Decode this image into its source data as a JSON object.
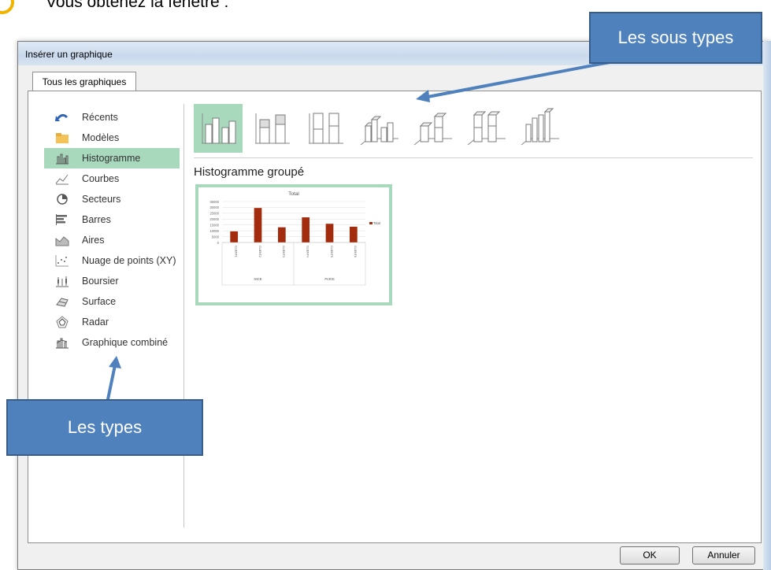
{
  "top_caption": "Vous obtenez la fenêtre :",
  "dialog": {
    "title": "Insérer un graphique",
    "tab_label": "Tous les graphiques",
    "chart_types": [
      {
        "label": "Récents",
        "icon": "recent-icon"
      },
      {
        "label": "Modèles",
        "icon": "folder-icon"
      },
      {
        "label": "Histogramme",
        "icon": "column-chart-icon",
        "selected": true
      },
      {
        "label": "Courbes",
        "icon": "line-chart-icon"
      },
      {
        "label": "Secteurs",
        "icon": "pie-chart-icon"
      },
      {
        "label": "Barres",
        "icon": "bar-chart-icon"
      },
      {
        "label": "Aires",
        "icon": "area-chart-icon"
      },
      {
        "label": "Nuage de points (XY)",
        "icon": "scatter-chart-icon"
      },
      {
        "label": "Boursier",
        "icon": "stock-chart-icon"
      },
      {
        "label": "Surface",
        "icon": "surface-chart-icon"
      },
      {
        "label": "Radar",
        "icon": "radar-chart-icon"
      },
      {
        "label": "Graphique combiné",
        "icon": "combo-chart-icon"
      }
    ],
    "subtype_title": "Histogramme groupé",
    "ok_label": "OK",
    "cancel_label": "Annuler"
  },
  "preview_chart": {
    "title": "Total",
    "legend": "Total",
    "y_ticks": [
      "35000",
      "30000",
      "25000",
      "20000",
      "15000",
      "10000",
      "5000",
      "0"
    ],
    "categories": [
      "CLIENT1",
      "CLIENT2",
      "CLIENT3",
      "CLIENT4",
      "CLIENT5",
      "CLIENT6"
    ],
    "groups": [
      "NICE",
      "PARIS"
    ]
  },
  "chart_data": {
    "type": "bar",
    "title": "Total",
    "categories": [
      "CLIENT1",
      "CLIENT2",
      "CLIENT3",
      "CLIENT4",
      "CLIENT5",
      "CLIENT6"
    ],
    "groups": [
      "NICE",
      "NICE",
      "NICE",
      "PARIS",
      "PARIS",
      "PARIS"
    ],
    "series": [
      {
        "name": "Total",
        "values": [
          9500,
          29500,
          13000,
          21500,
          16000,
          13500
        ],
        "color": "#a32b0e"
      }
    ],
    "ylim": [
      0,
      35000
    ],
    "legend": "right"
  },
  "callouts": {
    "sous_types": "Les sous types",
    "types": "Les types"
  },
  "colors": {
    "accent_selection": "#a9d9bd",
    "callout_fill": "#4f81bd",
    "bar": "#a32b0e"
  }
}
